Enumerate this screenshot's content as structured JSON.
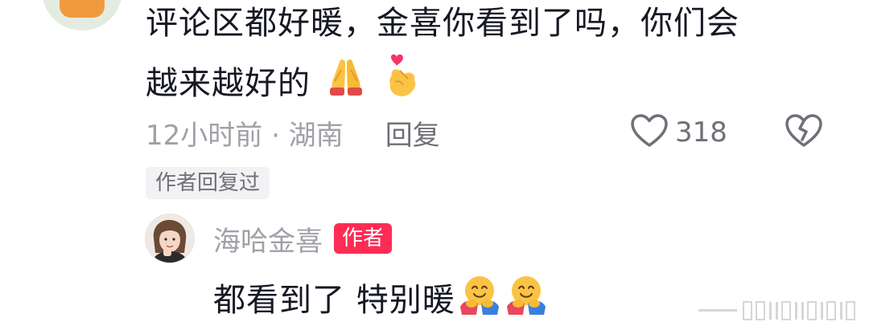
{
  "comment": {
    "line1": "评论区都好暖，金喜你看到了吗，你们会",
    "line2": "越来越好的",
    "emojis": [
      "folded-hands-icon",
      "finger-heart-icon"
    ],
    "time_location": "12小时前 · 湖南",
    "reply_label": "回复",
    "like_count": "318",
    "author_replied_tag": "作者回复过"
  },
  "reply": {
    "username": "海哈金喜",
    "badge": "作者",
    "text": "都看到了 特别暖",
    "emojis": [
      "hugging-face-icon",
      "hugging-face-icon"
    ]
  },
  "colors": {
    "text": "#161823",
    "muted": "#a0a1a7",
    "author_badge": "#fe2c55",
    "tag_bg": "#f2f2f4"
  }
}
